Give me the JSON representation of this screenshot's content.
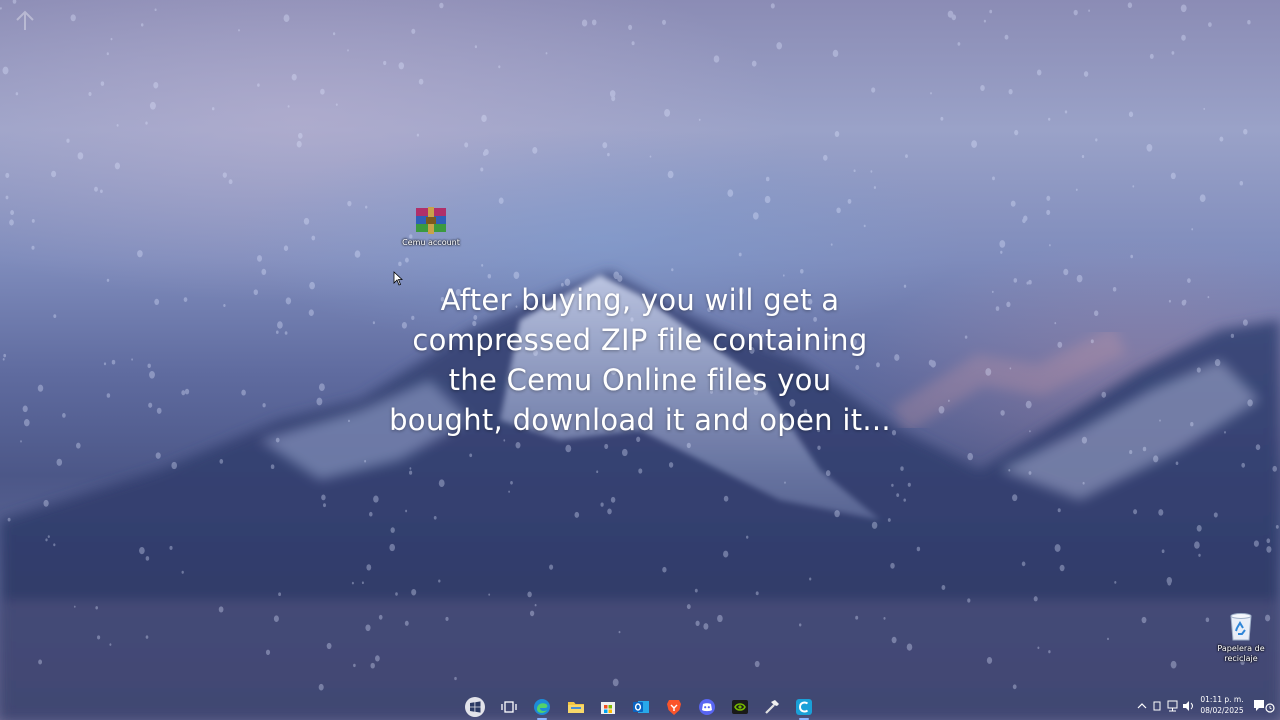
{
  "desktop": {
    "icons": [
      {
        "name": "cemu-account-zip",
        "label": "Cemu account",
        "icon": "winrar-archive-icon"
      },
      {
        "name": "recycle-bin",
        "label": "Papelera de reciclaje",
        "icon": "recycle-bin-icon"
      }
    ],
    "caption": {
      "lines": [
        "After buying, you will get a",
        "compressed ZIP file containing",
        "the Cemu Online files you",
        "bought, download it and open it..."
      ]
    }
  },
  "taskbar": {
    "apps": [
      {
        "name": "start",
        "icon": "windows-start-icon"
      },
      {
        "name": "task-view",
        "icon": "task-view-icon"
      },
      {
        "name": "edge",
        "icon": "edge-icon"
      },
      {
        "name": "file-explorer",
        "icon": "folder-icon"
      },
      {
        "name": "microsoft-store",
        "icon": "store-icon"
      },
      {
        "name": "outlook",
        "icon": "outlook-icon"
      },
      {
        "name": "brave",
        "icon": "brave-icon"
      },
      {
        "name": "discord",
        "icon": "discord-icon"
      },
      {
        "name": "nvidia",
        "icon": "nvidia-icon"
      },
      {
        "name": "hammer-tool",
        "icon": "hammer-icon"
      },
      {
        "name": "cemu",
        "icon": "cemu-icon"
      }
    ],
    "clock": {
      "time": "01:11 p. m.",
      "date": "08/02/2025"
    }
  },
  "colors": {
    "accent": "#8ab4ff"
  }
}
